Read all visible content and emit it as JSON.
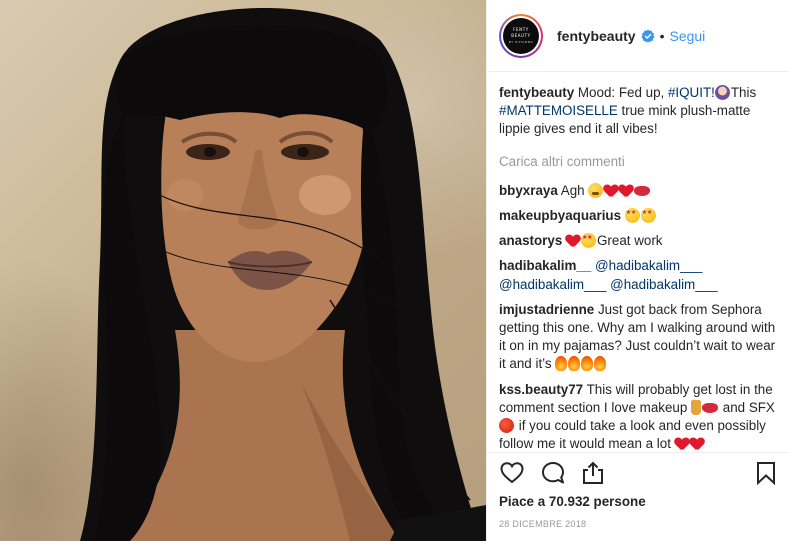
{
  "post": {
    "username": "fentybeauty",
    "follow_label": "Segui",
    "separator": "•",
    "avatar_text": "FENTY BEAUTY",
    "avatar_subtext": "BY RIHANNA"
  },
  "caption": {
    "username": "fentybeauty",
    "text_1": "Mood: Fed up, ",
    "hashtag_1": "#IQUIT!",
    "text_2": "This ",
    "hashtag_2": "#MATTEMOISELLE",
    "text_3": " true mink plush-matte lippie gives end it all vibes!"
  },
  "load_more_label": "Carica altri commenti",
  "comments": [
    {
      "username": "bbyxraya",
      "text": "Agh"
    },
    {
      "username": "makeupbyaquarius",
      "text": ""
    },
    {
      "username": "anastorys",
      "text": "Great work"
    },
    {
      "username": "hadibakalim__",
      "mention_1": "@hadibakalim___",
      "mention_2": "@hadibakalim___",
      "mention_3": "@hadibakalim___"
    },
    {
      "username": "imjustadrienne",
      "text": "Just got back from Sephora getting this one. Why am I walking around with it on in my pajamas? Just couldn’t wait to wear it and it’s "
    },
    {
      "username": "kss.beauty77",
      "text_1": "This will probably get lost in the comment section I love makeup ",
      "text_2": " and SFX ",
      "text_3": " if you could take a look and even possibly follow me it would mean a lot "
    }
  ],
  "likes_label": "Piace a 70.932 persone",
  "date_label": "28 DICEMBRE 2018",
  "icons": [
    "heart-icon",
    "comment-icon",
    "share-icon",
    "bookmark-icon",
    "verified-badge-icon"
  ],
  "colors": {
    "link": "#3897f0",
    "hashtag": "#003569",
    "muted": "#999999",
    "verified": "#3897f0"
  }
}
